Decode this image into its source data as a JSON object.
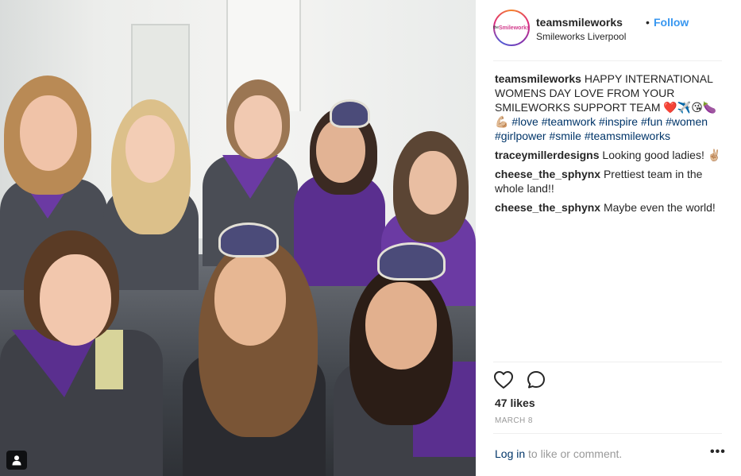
{
  "post": {
    "username": "teamsmileworks",
    "follow_label": "Follow",
    "separator": "•",
    "location": "Smileworks Liverpool",
    "avatar_text_prefix": "the",
    "avatar_text_brand": "Smileworks"
  },
  "caption": {
    "author": "teamsmileworks",
    "text": "HAPPY INTERNATIONAL WOMENS DAY LOVE FROM YOUR SMILEWORKS SUPPORT TEAM ❤️✈️😘🍆💪🏼",
    "hashtags": [
      "#love",
      "#teamwork",
      "#inspire",
      "#fun",
      "#women",
      "#girlpower",
      "#smile",
      "#teamsmileworks"
    ]
  },
  "comments": [
    {
      "author": "traceymillerdesigns",
      "text": "Looking good ladies! ✌🏼"
    },
    {
      "author": "cheese_the_sphynx",
      "text": "Prettiest team in the whole land!!"
    },
    {
      "author": "cheese_the_sphynx",
      "text": "Maybe even the world!"
    }
  ],
  "stats": {
    "likes": "47 likes",
    "date": "MARCH 8"
  },
  "footer": {
    "login_link": "Log in",
    "login_rest": "to like or comment.",
    "more_label": "•••"
  },
  "icons": {
    "like": "heart-icon",
    "comment": "comment-icon",
    "tagged": "user-tag-icon",
    "more": "more-options-icon"
  },
  "colors": {
    "link_blue": "#3897f0",
    "hashtag_blue": "#003569",
    "uniform_purple": "#5a2f8f",
    "uniform_grey": "#4a4d55"
  }
}
